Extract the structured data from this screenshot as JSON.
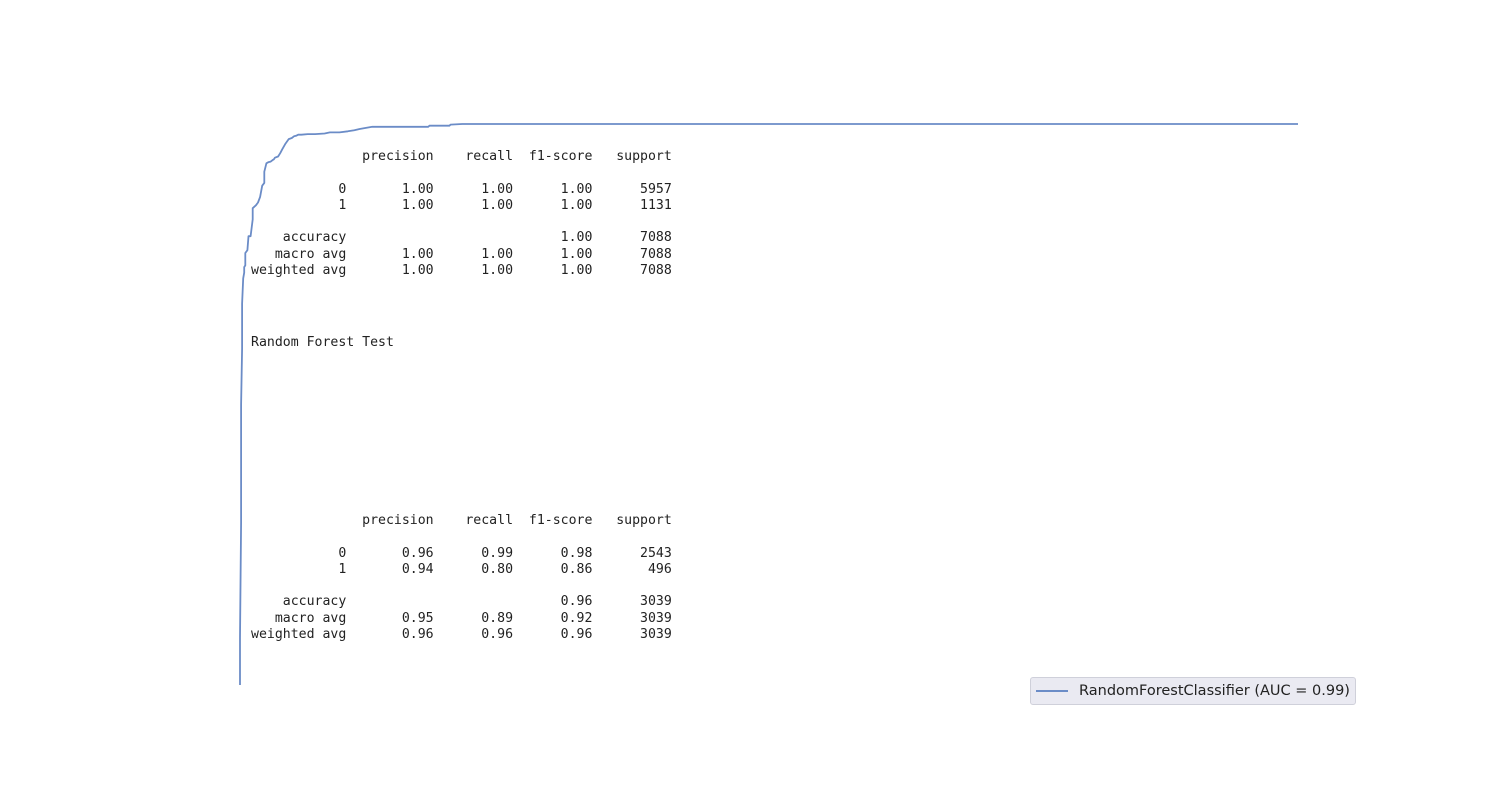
{
  "chart_data": {
    "type": "line",
    "title": "",
    "xlabel": "",
    "ylabel": "",
    "xlim": [
      0,
      1
    ],
    "ylim": [
      0,
      1
    ],
    "grid": false,
    "legend_position": "bottom-right",
    "series": [
      {
        "name": "RandomForestClassifier (AUC = 0.99)",
        "color": "#6b8cc7",
        "x": [
          0,
          0,
          0.001,
          0.001,
          0.002,
          0.002,
          0.003,
          0.004,
          0.004,
          0.005,
          0.005,
          0.007,
          0.008,
          0.01,
          0.012,
          0.012,
          0.015,
          0.017,
          0.019,
          0.021,
          0.023,
          0.023,
          0.025,
          0.027,
          0.029,
          0.031,
          0.032,
          0.033,
          0.036,
          0.038,
          0.04,
          0.043,
          0.046,
          0.049,
          0.051,
          0.053,
          0.055,
          0.058,
          0.064,
          0.071,
          0.08,
          0.085,
          0.094,
          0.102,
          0.108,
          0.113,
          0.125,
          0.14,
          0.178,
          0.179,
          0.198,
          0.199,
          0.21,
          1.0
        ],
        "y": [
          0,
          0.085,
          0.29,
          0.5,
          0.6,
          0.68,
          0.725,
          0.735,
          0.745,
          0.748,
          0.77,
          0.775,
          0.8,
          0.8,
          0.83,
          0.85,
          0.855,
          0.86,
          0.87,
          0.89,
          0.895,
          0.915,
          0.93,
          0.932,
          0.933,
          0.936,
          0.937,
          0.94,
          0.942,
          0.948,
          0.955,
          0.965,
          0.973,
          0.975,
          0.978,
          0.979,
          0.981,
          0.981,
          0.982,
          0.982,
          0.983,
          0.985,
          0.985,
          0.987,
          0.989,
          0.991,
          0.995,
          0.995,
          0.995,
          0.997,
          0.997,
          0.999,
          1.0,
          1.0
        ]
      }
    ]
  },
  "report_train": {
    "lines": [
      "              precision    recall  f1-score   support",
      "",
      "           0       1.00      1.00      1.00      5957",
      "           1       1.00      1.00      1.00      1131",
      "",
      "    accuracy                           1.00      7088",
      "   macro avg       1.00      1.00      1.00      7088",
      "weighted avg       1.00      1.00      1.00      7088"
    ]
  },
  "test_title": "Random Forest Test",
  "report_test": {
    "lines": [
      "              precision    recall  f1-score   support",
      "",
      "           0       0.96      0.99      0.98      2543",
      "           1       0.94      0.80      0.86       496",
      "",
      "    accuracy                           0.96      3039",
      "   macro avg       0.95      0.89      0.92      3039",
      "weighted avg       0.96      0.96      0.96      3039"
    ]
  },
  "legend": {
    "label": "RandomForestClassifier (AUC = 0.99)"
  }
}
